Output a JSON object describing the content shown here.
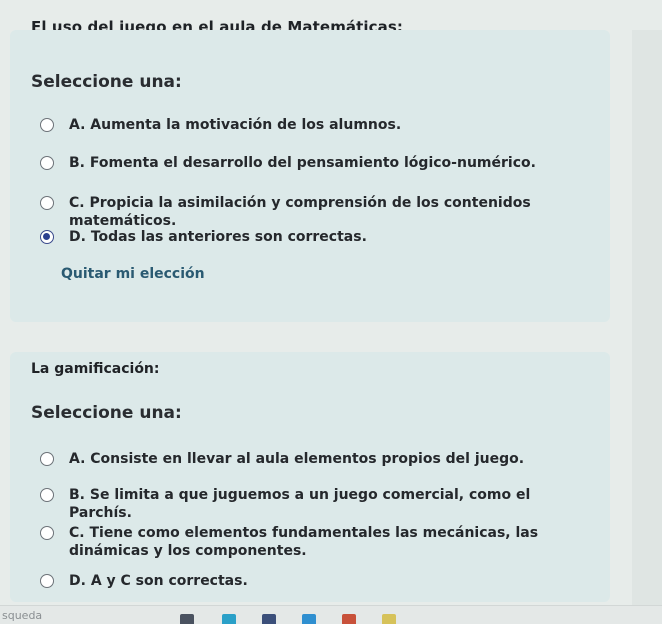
{
  "question1": {
    "title": "El uso del juego en el aula de Matemáticas:",
    "prompt": "Seleccione una:",
    "options": [
      {
        "label": "A. Aumenta la motivación de los alumnos.",
        "selected": false
      },
      {
        "label": "B. Fomenta el desarrollo del pensamiento lógico-numérico.",
        "selected": false
      },
      {
        "label": "C. Propicia la asimilación y comprensión de los contenidos matemáticos.",
        "selected": false
      },
      {
        "label": "D. Todas las anteriores son correctas.",
        "selected": true
      }
    ],
    "clear_choice": "Quitar mi elección"
  },
  "question2": {
    "title": "La gamiﬁcación:",
    "prompt": "Seleccione una:",
    "options": [
      {
        "label": "A. Consiste en llevar al aula elementos propios del juego.",
        "selected": false
      },
      {
        "label": "B. Se limita a que juguemos a un juego comercial, como el Parchís.",
        "selected": false
      },
      {
        "label": "C. Tiene como elementos fundamentales las mecánicas, las dinámicas y los componentes.",
        "selected": false
      },
      {
        "label": "D. A y C son correctas.",
        "selected": false
      }
    ]
  },
  "taskbar": {
    "search_text": "squeda"
  },
  "colors": {
    "card_bg": "#dce9e9",
    "selected_radio": "#2a3f8f",
    "link": "#2a5a72"
  }
}
